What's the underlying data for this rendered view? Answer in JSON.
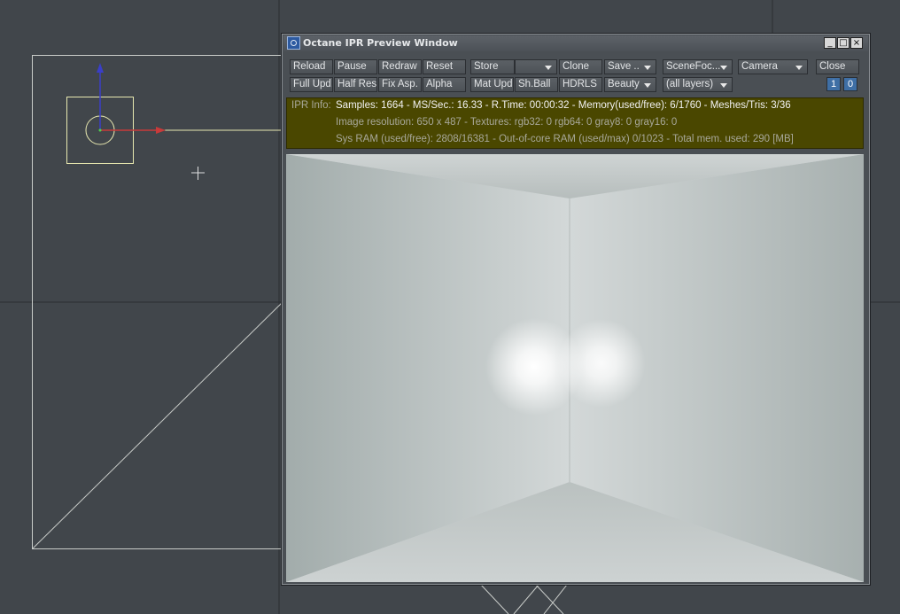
{
  "window": {
    "title": "Octane IPR Preview Window",
    "controls": {
      "minimize": "_",
      "maximize": "□",
      "close": "×"
    }
  },
  "toolbar": {
    "row1": {
      "reload": "Reload",
      "pause": "Pause",
      "redraw": "Redraw",
      "reset": "Reset",
      "store": "Store",
      "store_select": "",
      "clone": "Clone",
      "save": "Save ..",
      "scene_focus": "SceneFoc...",
      "camera": "Camera",
      "close": "Close"
    },
    "row2": {
      "full_update": "Full Upd.",
      "half_res": "Half Res",
      "fix_aspect": "Fix Asp.",
      "alpha": "Alpha",
      "mat_update": "Mat Upd",
      "sh_ball": "Sh.Ball",
      "hdrls": "HDRLS",
      "beauty": "Beauty",
      "layers": "(all layers)",
      "num_1": "1",
      "num_0": "0"
    }
  },
  "info": {
    "label": "IPR Info:",
    "line1": "Samples: 1664  -  MS/Sec.: 16.33  -  R.Time: 00:00:32 - Memory(used/free): 6/1760  -  Meshes/Tris: 3/36",
    "line2": "Image resolution: 650 x 487  -  Textures:  rgb32: 0   rgb64: 0   gray8: 0   gray16: 0",
    "line3": "Sys RAM (used/free): 2808/16381  -  Out-of-core RAM (used/max) 0/1023  -  Total mem. used: 290  [MB]"
  },
  "colors": {
    "viewport_bg": "#41464b",
    "info_bg": "#4a4700",
    "accent_blue": "#3f6fa5",
    "light_yellow": "#f0f0c0"
  }
}
